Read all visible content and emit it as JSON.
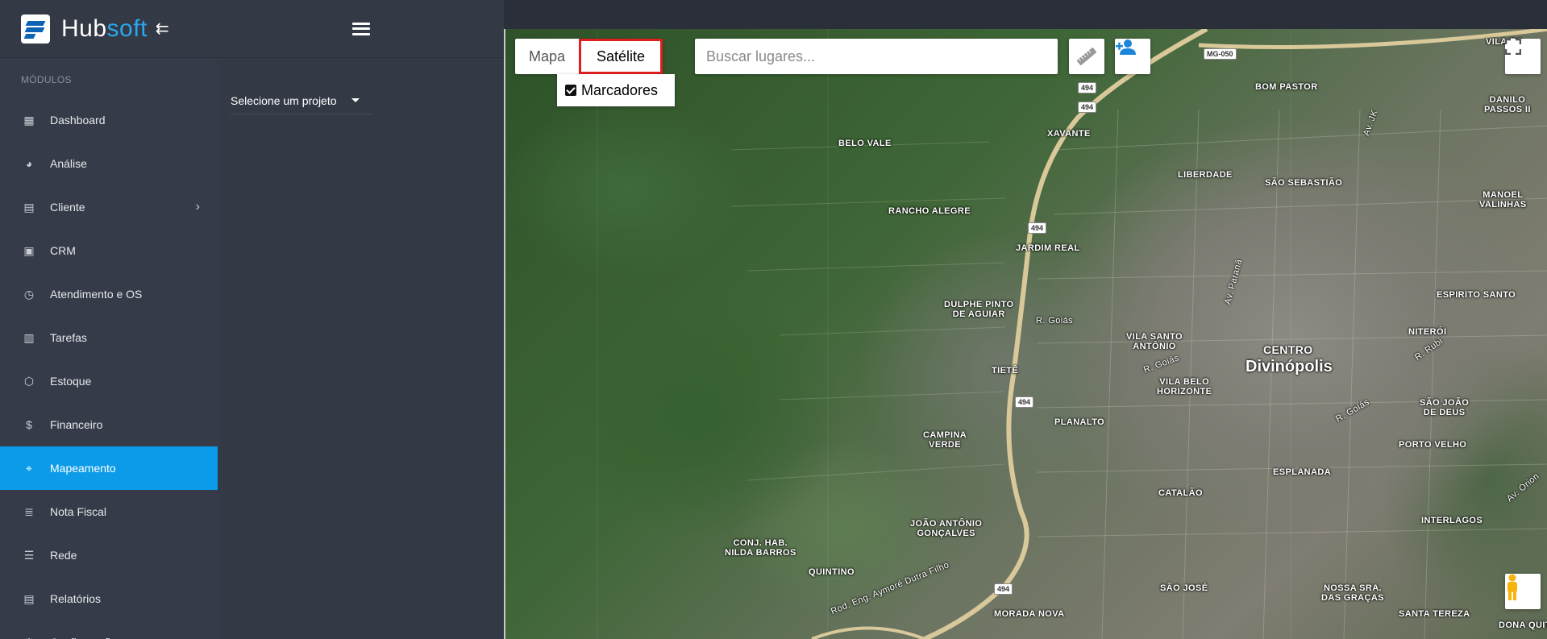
{
  "brand": {
    "name_part1": "Hub",
    "name_part2": "soft",
    "collapse_icon": "collapse-menu-icon"
  },
  "sidebar": {
    "section_label": "MÓDULOS",
    "items": [
      {
        "label": "Dashboard",
        "icon": "dashboard-icon",
        "glyph": "▦"
      },
      {
        "label": "Análise",
        "icon": "pie-chart-icon",
        "glyph": "◕"
      },
      {
        "label": "Cliente",
        "icon": "contact-card-icon",
        "glyph": "▤",
        "chevron": "›"
      },
      {
        "label": "CRM",
        "icon": "board-icon",
        "glyph": "▣"
      },
      {
        "label": "Atendimento e OS",
        "icon": "calendar-clock-icon",
        "glyph": "◷"
      },
      {
        "label": "Tarefas",
        "icon": "tasks-icon",
        "glyph": "▥"
      },
      {
        "label": "Estoque",
        "icon": "box-icon",
        "glyph": "⬡"
      },
      {
        "label": "Financeiro",
        "icon": "money-icon",
        "glyph": "$"
      },
      {
        "label": "Mapeamento",
        "icon": "map-pin-icon",
        "glyph": "⌖",
        "active": true
      },
      {
        "label": "Nota Fiscal",
        "icon": "receipt-icon",
        "glyph": "≣"
      },
      {
        "label": "Rede",
        "icon": "server-icon",
        "glyph": "☰"
      },
      {
        "label": "Relatórios",
        "icon": "document-icon",
        "glyph": "▤"
      },
      {
        "label": "Configuração",
        "icon": "gear-icon",
        "glyph": "⚙",
        "chevron": "›"
      }
    ]
  },
  "panel": {
    "project_select_label": "Selecione um projeto"
  },
  "map": {
    "type_options": {
      "map": "Mapa",
      "satellite": "Satélite"
    },
    "selected_type": "Satélite",
    "markers_label": "Marcadores",
    "markers_checked": true,
    "search_placeholder": "Buscar lugares...",
    "labels": {
      "belo_vale": "BELO VALE",
      "rancho_alegre": "RANCHO ALEGRE",
      "xavante": "XAVANTE",
      "bom_pastor": "BOM PASTOR",
      "danilo_passos": "DANILO\nPASSOS II",
      "liberdade": "LIBERDADE",
      "sao_sebastiao": "SÃO SEBASTIÃO",
      "manoel_valinhas": "MANOEL\nVALINHAS",
      "jardim_real": "JARDIM REAL",
      "espirito_santo": "ESPIRITO SANTO",
      "dulphe_pinto": "DULPHE PINTO\nDE AGUIAR",
      "r_goias_1": "R. Goiás",
      "vila_santo_antonio": "VILA SANTO\nANTÔNIO",
      "centro": "CENTRO",
      "divinopolis": "Divinópolis",
      "niteroi": "NITERÓI",
      "tiete": "TIETÊ",
      "vila_belo_horizonte": "VILA BELO\nHORIZONTE",
      "sao_joao_de_deus": "SÃO JOÃO\nDE DEUS",
      "planalto": "PLANALTO",
      "campina_verde": "CAMPINA\nVERDE",
      "porto_velho": "PORTO VELHO",
      "esplanada": "ESPLANADA",
      "catalao": "CATALÃO",
      "joao_antonio": "JOÃO ANTÔNIO\nGONÇALVES",
      "interlagos": "INTERLAGOS",
      "conj_hab": "CONJ. HAB.\nNILDA BARROS",
      "quintino": "QUINTINO",
      "sao_jose": "SÃO JOSÉ",
      "nossa_sra": "NOSSA SRA.\nDAS GRAÇAS",
      "morada_nova": "MORADA NOVA",
      "santa_tereza": "SANTA TEREZA",
      "dona_quit": "DONA QUIT",
      "vila_ro": "VILA RO",
      "rod_eng": "Rod. Eng. Aymoré Dutra Filho",
      "av_parana": "Av. Paraná",
      "r_goias_2": "R. Goiás",
      "r_goias_3": "R. Goiás",
      "r_rubi": "R. Rubi",
      "av_jk": "Av. JK",
      "av_orion": "Av. Órion"
    },
    "road_tags": {
      "mg050": "MG-050",
      "r494a": "494",
      "r494b": "494",
      "r494c": "494",
      "r494d": "494",
      "r494e": "494",
      "r494f": "494"
    }
  }
}
